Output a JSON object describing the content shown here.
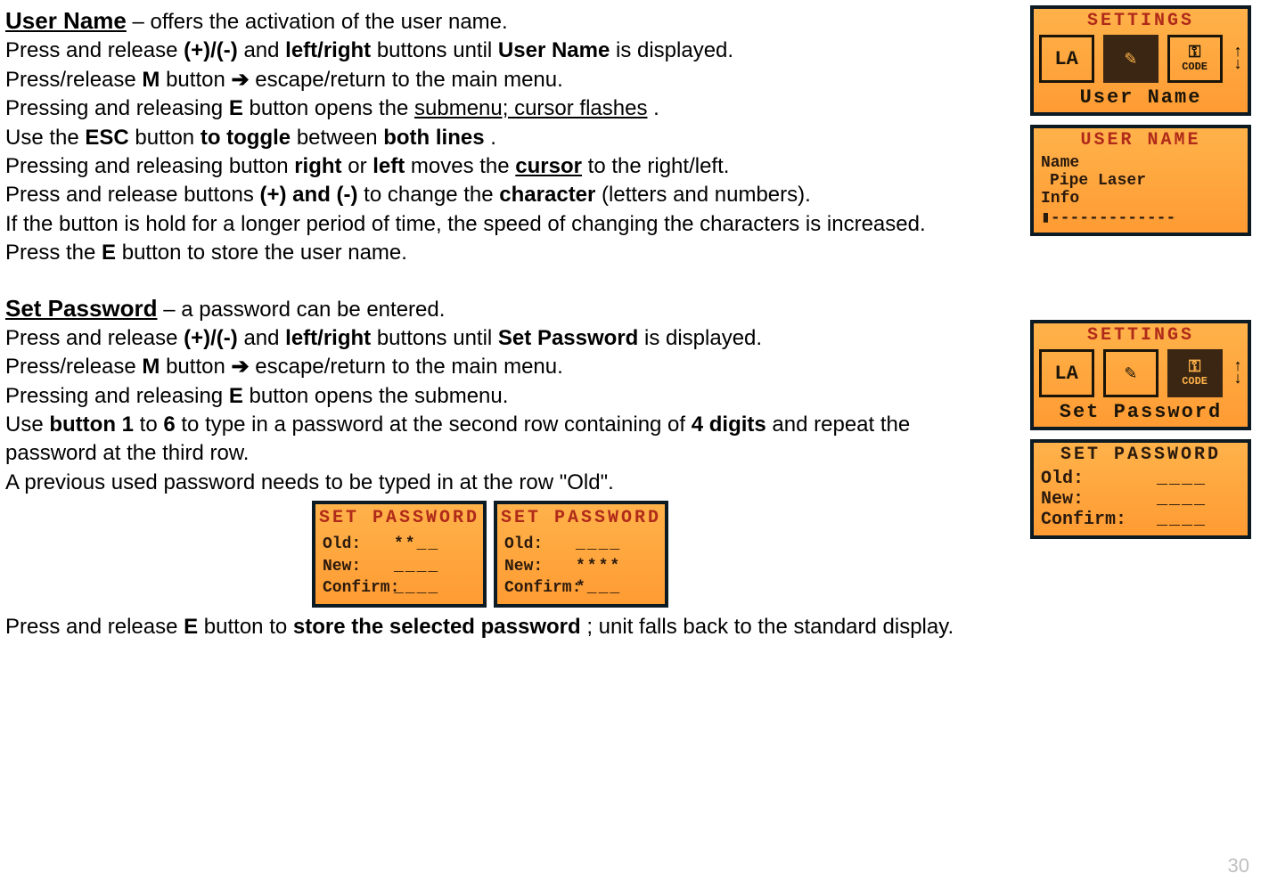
{
  "section1": {
    "title": "User Name",
    "subtitle": " – offers the activation of the user name.",
    "l1_a": "Press and release ",
    "l1_b": "(+)/(-)",
    "l1_c": " and ",
    "l1_d": "left/right",
    "l1_e": " buttons until ",
    "l1_f": "User Name",
    "l1_g": " is displayed.",
    "l2_a": "Press/release ",
    "l2_b": "M",
    "l2_c": " button ",
    "arrow": "➔",
    "l2_d": " escape/return to the main menu.",
    "l3_a": "Pressing and releasing ",
    "l3_b": "E",
    "l3_c": " button opens the ",
    "l3_d": "submenu; cursor flashes",
    "l3_e": ".",
    "l4_a": "Use the ",
    "l4_b": "ESC",
    "l4_c": " button ",
    "l4_d": "to toggle",
    "l4_e": " between ",
    "l4_f": "both lines",
    "l4_g": ".",
    "l5_a": "Pressing and releasing button ",
    "l5_b": "right",
    "l5_c": " or ",
    "l5_d": "left",
    "l5_e": " moves the ",
    "l5_f": "cursor",
    "l5_g": " to the right/left.",
    "l6_a": "Press and release buttons ",
    "l6_b": "(+) and (-)",
    "l6_c": " to change the ",
    "l6_d": "character",
    "l6_e": " (letters and numbers).",
    "l7": "If the button is hold for a longer period of time, the speed of changing the characters is increased.",
    "l8_a": "Press the ",
    "l8_b": "E",
    "l8_c": " button to store the user name."
  },
  "section2": {
    "title": "Set Password",
    "subtitle": " – a password can be entered.",
    "l1_a": "Press and release ",
    "l1_b": "(+)/(-)",
    "l1_c": " and ",
    "l1_d": "left/right",
    "l1_e": " buttons until ",
    "l1_f": "Set Password",
    "l1_g": " is displayed.",
    "l2_a": "Press/release ",
    "l2_b": "M",
    "l2_c": " button ",
    "arrow": "➔",
    "l2_d": " escape/return to the main menu.",
    "l3_a": "Pressing and releasing ",
    "l3_b": "E",
    "l3_c": " button opens the submenu.",
    "l4_a": "Use ",
    "l4_b": "button 1",
    "l4_c": " to ",
    "l4_d": "6",
    "l4_e": " to type in a password at the second row containing of ",
    "l4_f": "4 digits",
    "l4_g": " and repeat the password at the third row.",
    "l5": "A previous used password needs to be typed in at the row \"Old\".",
    "l6_a": "Press and release ",
    "l6_b": "E",
    "l6_c": " button to ",
    "l6_d": "store the selected password",
    "l6_e": "; unit falls back to the standard display."
  },
  "lcd": {
    "settings": "SETTINGS",
    "user_name_footer": "User Name",
    "set_password_footer": "Set Password",
    "la": "LA",
    "note_icon": "✎",
    "code": "CODE",
    "key": "⚿",
    "up": "↑",
    "down": "↓",
    "username_hdr": "USER NAME",
    "name_lbl": "Name",
    "name_val": "Pipe Laser",
    "info_lbl": "Info",
    "info_val": "▮-------------",
    "setpw_hdr": "SET PASSWORD",
    "old_lbl": "Old:",
    "new_lbl": "New:",
    "confirm_lbl": "Confirm:",
    "blank4": "____",
    "pw_a_old": "**__",
    "pw_b_new": "****",
    "pw_b_confirm": "*___"
  },
  "page_number": "30"
}
